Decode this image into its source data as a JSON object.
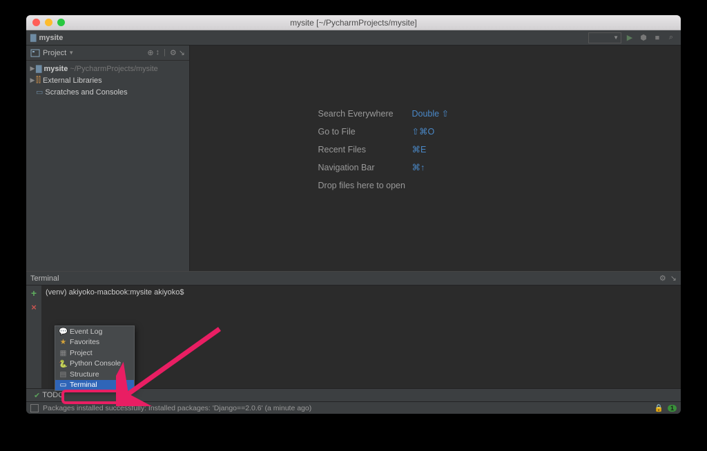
{
  "titlebar": {
    "title": "mysite [~/PycharmProjects/mysite]"
  },
  "navbar": {
    "project_name": "mysite"
  },
  "project_tool": {
    "label": "Project",
    "root": {
      "name": "mysite",
      "path": "~/PycharmProjects/mysite"
    },
    "ext_lib": "External Libraries",
    "scratches": "Scratches and Consoles"
  },
  "welcome": {
    "rows": [
      {
        "label": "Search Everywhere",
        "shortcut": "Double ⇧"
      },
      {
        "label": "Go to File",
        "shortcut": "⇧⌘O"
      },
      {
        "label": "Recent Files",
        "shortcut": "⌘E"
      },
      {
        "label": "Navigation Bar",
        "shortcut": "⌘↑"
      },
      {
        "label": "Drop files here to open",
        "shortcut": ""
      }
    ]
  },
  "terminal_head": "Terminal",
  "terminal_prompt": "(venv) akiyoko-macbook:mysite akiyoko$",
  "context_menu": {
    "items": [
      {
        "icon": "💬",
        "label": "Event Log"
      },
      {
        "icon": "★",
        "label": "Favorites"
      },
      {
        "icon": "▦",
        "label": "Project"
      },
      {
        "icon": "🐍",
        "label": "Python Console"
      },
      {
        "icon": "▤",
        "label": "Structure"
      },
      {
        "icon": "▭",
        "label": "Terminal"
      }
    ],
    "selected_index": 5
  },
  "bottom_tabs": {
    "todo": "TODO"
  },
  "statusbar": {
    "message": "Packages installed successfully: Installed packages: 'Django==2.0.6' (a minute ago)",
    "badge": "1"
  }
}
